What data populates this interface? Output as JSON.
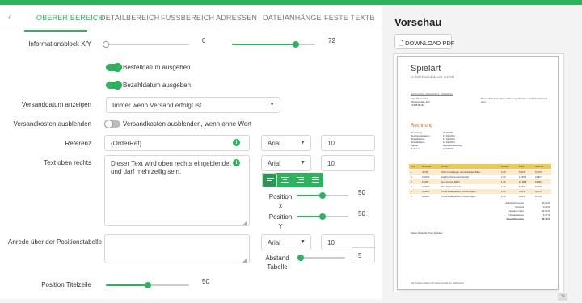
{
  "tabs": [
    {
      "label": "OBERER BEREICH",
      "active": true
    },
    {
      "label": "DETAILBEREICH",
      "active": false
    },
    {
      "label": "FUSSBEREICH",
      "active": false
    },
    {
      "label": "ADRESSEN",
      "active": false
    },
    {
      "label": "DATEIANHÄNGE",
      "active": false
    },
    {
      "label": "FESTE TEXTE",
      "active": false
    }
  ],
  "form": {
    "infoblock": {
      "label": "Informationsblock X/Y",
      "x_value": "0",
      "y_value": "72",
      "x_level": 0.0,
      "y_level": 0.77
    },
    "bestelldatum": {
      "label": "Bestelldatum ausgeben",
      "on": true
    },
    "bezahldatum": {
      "label": "Bezahldatum ausgeben",
      "on": true
    },
    "versanddatum": {
      "label": "Versanddatum anzeigen",
      "value": "Immer wenn Versand erfolgt ist"
    },
    "versandkosten": {
      "label": "Versandkosten ausblenden",
      "toggle_label": "Versandkosten ausblenden, wenn ohne Wert",
      "on": false
    },
    "referenz": {
      "label": "Referenz",
      "value": "{OrderRef}",
      "font": "Arial",
      "size": "10"
    },
    "text_oben_rechts": {
      "label": "Text oben rechts",
      "value": "Dieser Text wird oben rechts eingeblendet und darf mehrzeilig sein.",
      "font": "Arial",
      "size": "10",
      "position_x_label": "Position X",
      "position_x_value": "50",
      "position_x_level": 0.5,
      "position_y_label": "Position Y",
      "position_y_value": "50",
      "position_y_level": 0.5
    },
    "anrede": {
      "label": "Anrede über der Positionstabelle",
      "value": "",
      "font": "Arial",
      "size": "10",
      "abstand_label": "Abstand Tabelle",
      "abstand_value": "5",
      "abstand_level": 0.05
    },
    "titelzeile": {
      "label": "Position Titelzeile",
      "value": "50",
      "level": 0.5
    }
  },
  "preview": {
    "title": "Vorschau",
    "download_label": "DOWNLOAD PDF",
    "doc": {
      "brand": "Spielart",
      "tagline": "Goldschmiedekunst mit Stil",
      "sender_line": "Spielart GmbH · Musterstraße 1 · 12345 Berlin",
      "recipient": [
        "Frau Musterfrau",
        "Musterstraße 123",
        "12345 Berlin"
      ],
      "info_text": "Dieser Text wird oben rechts eingeblendet und darf mehrzeilig sein.",
      "heading": "Rechnung",
      "meta": [
        [
          "Rechnung",
          "2010368"
        ],
        [
          "Rechnungsdatum",
          "13.01.2021"
        ],
        [
          "Bestelldatum",
          "11.01.2021"
        ],
        [
          "Bezahldatum",
          "11.01.2021"
        ],
        [
          "Zahlart",
          "Banküberweisung"
        ],
        [
          "Referenz",
          "12345678"
        ]
      ],
      "table_header": [
        "Pos",
        "Nummer",
        "Artikel",
        "Anzahl",
        "Preis",
        "Summe"
      ],
      "rows": [
        [
          "1",
          "44720",
          "6,8 mm Anhänger Herzstück aus Silber",
          "1,00",
          "5,90 €",
          "5,90 €"
        ],
        [
          "2",
          "121000",
          "Holzbox/Schmuckschachtel",
          "1,00",
          "11,80 €",
          "11,80 €"
        ],
        [
          "3",
          "12348",
          "Lina Armreif Silber",
          "1,00",
          "16,90 €",
          "16,90 €"
        ],
        [
          "4",
          "444600",
          "Tauchgoldohrstecker",
          "1,00",
          "5,00 €",
          "5,00 €"
        ],
        [
          "5",
          "444601",
          "Truhe Ledersachen mit Flechtgarn",
          "1,00",
          "0,80 €",
          "0,80 €"
        ],
        [
          "6",
          "444602",
          "Truhe Ledersachen mit Flechtgarn",
          "1,00",
          "0,00 €",
          "0,00 €"
        ]
      ],
      "totals": [
        [
          "Zwischensumme",
          "40,40 €"
        ],
        [
          "Versand",
          "0,00 €"
        ],
        [
          "Gesamt netto",
          "34,03 €"
        ],
        [
          "Umsatzsteuer",
          "6,37 €"
        ],
        [
          "Gesamtsumme",
          "40,40 €"
        ]
      ],
      "footer_note": "Vielen Dank für Ihren Einkauf.",
      "bottom_note": "Für Fragen stehen wir Ihnen gerne zur Verfügung."
    }
  },
  "colors": {
    "accent": "#2db35d",
    "row_highlight": "#f2c94c",
    "heading_orange": "#c7671f"
  }
}
